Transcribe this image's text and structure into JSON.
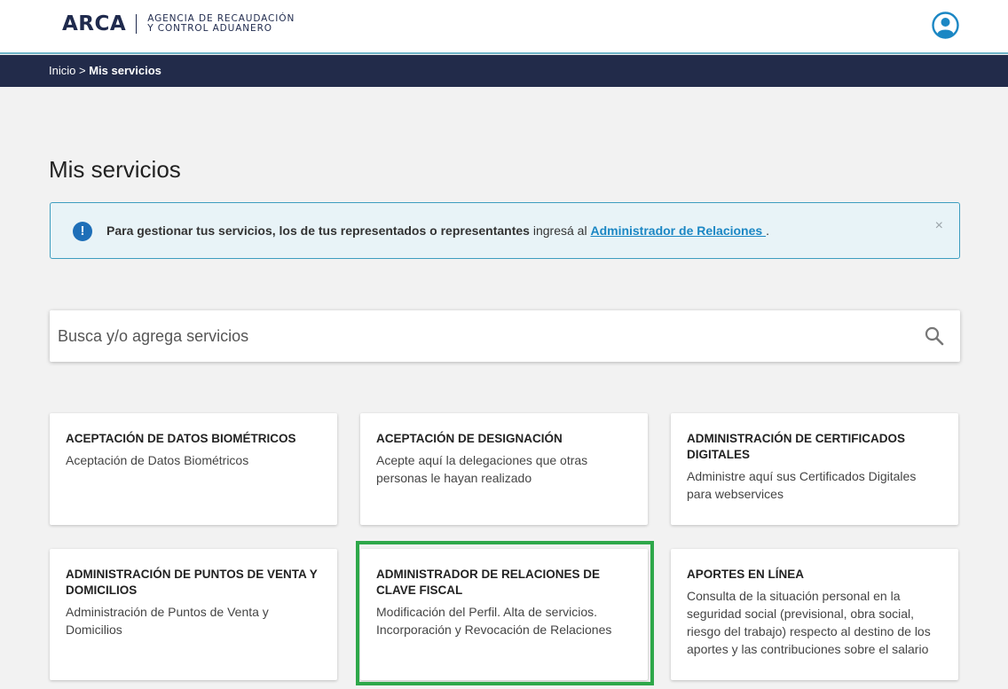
{
  "header": {
    "logo_mark": "ARCA",
    "logo_line1": "AGENCIA DE RECAUDACIÓN",
    "logo_line2": "Y CONTROL ADUANERO",
    "user_icon": "user-circle-icon"
  },
  "breadcrumb": {
    "home": "Inicio",
    "separator": ">",
    "current": "Mis servicios"
  },
  "page": {
    "title": "Mis servicios"
  },
  "alert": {
    "icon": "exclamation-circle-icon",
    "bold_text": "Para gestionar tus servicios, los de tus representados o representantes",
    "text": " ingresá al ",
    "link": "Administrador de Relaciones ",
    "end": ".",
    "close": "×"
  },
  "search": {
    "placeholder": "Busca y/o agrega servicios",
    "icon": "search-icon"
  },
  "services": [
    {
      "title": "ACEPTACIÓN DE DATOS BIOMÉTRICOS",
      "desc": "Aceptación de Datos Biométricos"
    },
    {
      "title": "ACEPTACIÓN DE DESIGNACIÓN",
      "desc": "Acepte aquí la delegaciones que otras personas le hayan realizado"
    },
    {
      "title": "ADMINISTRACIÓN DE CERTIFICADOS DIGITALES",
      "desc": "Administre aquí sus Certificados Digitales para webservices"
    },
    {
      "title": "ADMINISTRACIÓN DE PUNTOS DE VENTA Y DOMICILIOS",
      "desc": "Administración de Puntos de Venta y Domicilios"
    },
    {
      "title": "ADMINISTRADOR DE RELACIONES DE CLAVE FISCAL",
      "desc": "Modificación del Perfil. Alta de servicios. Incorporación y Revocación de Relaciones"
    },
    {
      "title": "APORTES EN LÍNEA",
      "desc": "Consulta de la situación personal en la seguridad social (previsional, obra social, riesgo del trabajo) respecto al destino de los aportes y las contribuciones sobre el salario"
    }
  ],
  "colors": {
    "navy": "#222b4a",
    "accent": "#1b87c4",
    "highlight": "#2ea84a"
  }
}
